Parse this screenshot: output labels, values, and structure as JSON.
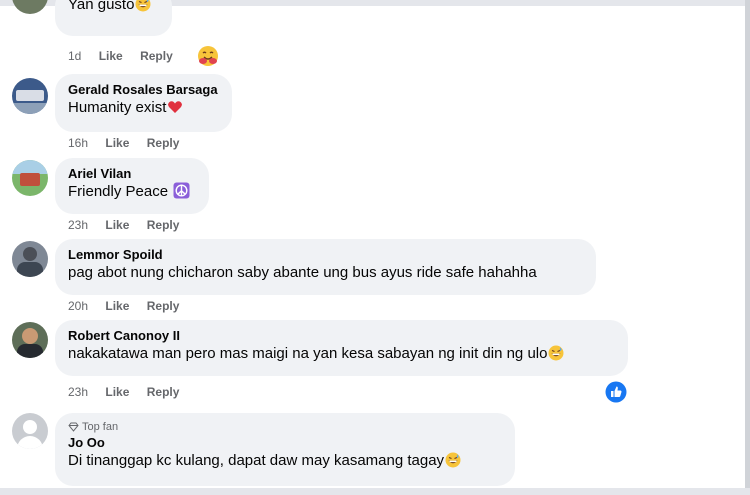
{
  "comments": [
    {
      "author": "",
      "text": "Yan gusto",
      "time": "1d",
      "like": "Like",
      "reply": "Reply",
      "emoji": "grinning-sweat-face",
      "reaction": "hug-face-reaction"
    },
    {
      "author": "Gerald Rosales Barsaga",
      "text": "Humanity exist",
      "time": "16h",
      "like": "Like",
      "reply": "Reply",
      "emoji": "red-heart"
    },
    {
      "author": "Ariel Vilan",
      "text": "Friendly Peace",
      "time": "23h",
      "like": "Like",
      "reply": "Reply",
      "emoji": "peace-symbol"
    },
    {
      "author": "Lemmor Spoild",
      "text": "pag abot nung chicharon saby abante ung bus ayus ride safe hahahha",
      "time": "20h",
      "like": "Like",
      "reply": "Reply"
    },
    {
      "author": "Robert Canonoy II",
      "text": "nakakatawa man pero mas maigi na yan kesa sabayan ng init din ng ulo",
      "time": "23h",
      "like": "Like",
      "reply": "Reply",
      "emoji": "grinning-sweat-face",
      "reaction": "like-reaction"
    },
    {
      "badge": "Top fan",
      "author": "Jo Oo",
      "text": "Di tinanggap kc kulang, dapat daw may kasamang tagay",
      "emoji": "grinning-sweat-face"
    }
  ]
}
